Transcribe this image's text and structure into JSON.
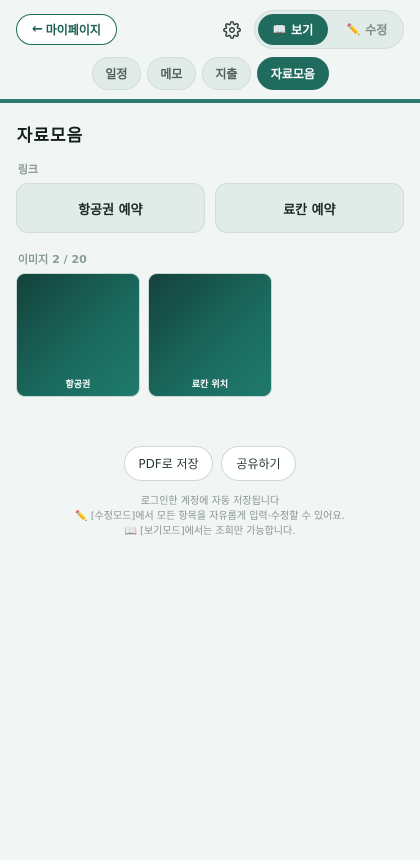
{
  "header": {
    "back_label": "마이페이지",
    "back_arrow": "←",
    "settings_icon": "gear-icon",
    "mode": {
      "view_label": "보기",
      "view_icon": "📖",
      "edit_label": "수정",
      "edit_icon": "✏️",
      "active": "view"
    }
  },
  "tabs": [
    {
      "label": "일정",
      "active": false
    },
    {
      "label": "메모",
      "active": false
    },
    {
      "label": "지출",
      "active": false
    },
    {
      "label": "자료모음",
      "active": true
    }
  ],
  "page": {
    "title": "자료모음",
    "links_label": "링크",
    "links": [
      {
        "label": "항공권 예약"
      },
      {
        "label": "료칸 예약"
      }
    ],
    "images_label": "이미지 2 / 20",
    "images": [
      {
        "caption": "항공권"
      },
      {
        "caption": "료칸 위치"
      }
    ]
  },
  "actions": {
    "pdf_label": "PDF로 저장",
    "share_label": "공유하기"
  },
  "footer": {
    "line1": "로그인한 계정에 자동 저장됩니다",
    "line2_icon": "✏️",
    "line2": "[수정모드]에서 모든 항목을 자유롭게 입력·수정할 수 있어요.",
    "line3_icon": "📖",
    "line3": "[보기모드]에서는 조회만 가능합니다."
  },
  "colors": {
    "accent": "#1f6b5e",
    "background": "#f1f5f3",
    "card": "#e1ebe7"
  }
}
